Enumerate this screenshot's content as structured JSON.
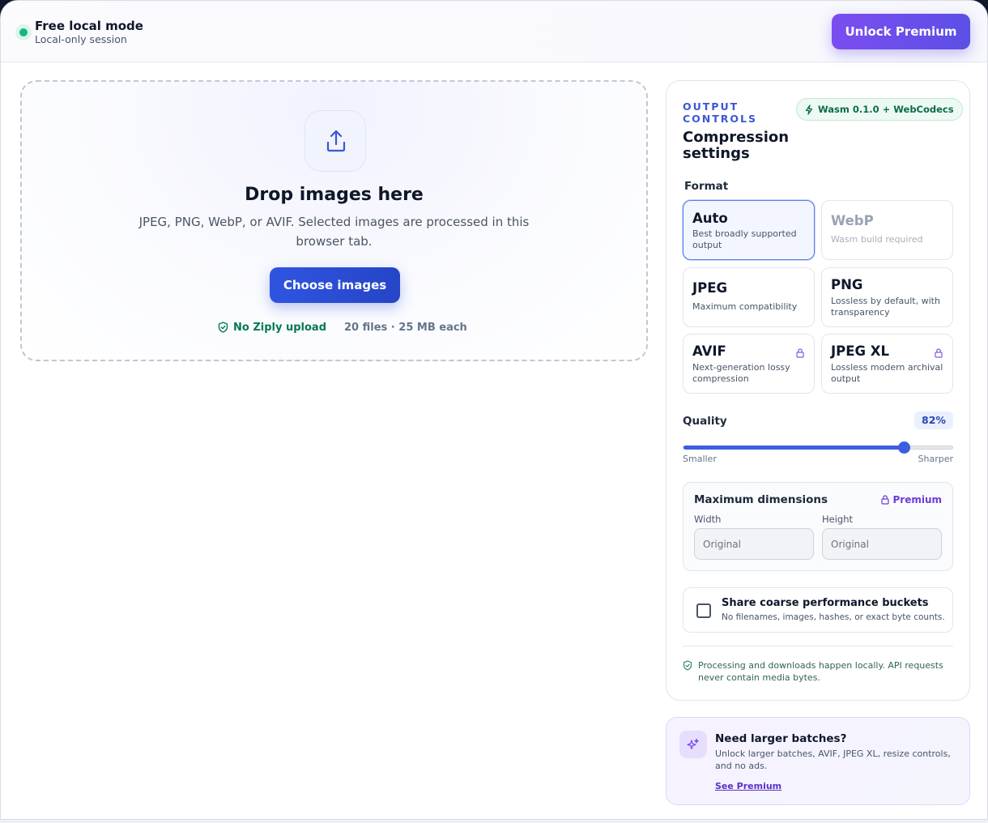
{
  "header": {
    "mode_title": "Free local mode",
    "mode_subtitle": "Local-only session",
    "unlock_label": "Unlock Premium",
    "status_color": "#10b981"
  },
  "dropzone": {
    "icon": "upload-icon",
    "title": "Drop images here",
    "subtitle": "JPEG, PNG, WebP, or AVIF. Selected images are processed in this browser tab.",
    "button_label": "Choose images",
    "no_upload_label": "No Ziply upload",
    "limits_label": "20 files · 25 MB each"
  },
  "panel": {
    "eyebrow": "OUTPUT CONTROLS",
    "title": "Compression settings",
    "engine_badge": "Wasm 0.1.0 + WebCodecs",
    "format_label": "Format",
    "formats": [
      {
        "name": "Auto",
        "desc": "Best broadly supported output",
        "state": "selected",
        "locked": false
      },
      {
        "name": "WebP",
        "desc": "Wasm build required",
        "state": "disabled",
        "locked": false
      },
      {
        "name": "JPEG",
        "desc": "Maximum compatibility",
        "state": "normal",
        "locked": false
      },
      {
        "name": "PNG",
        "desc": "Lossless by default, with transparency",
        "state": "normal",
        "locked": false
      },
      {
        "name": "AVIF",
        "desc": "Next-generation lossy compression",
        "state": "normal",
        "locked": true
      },
      {
        "name": "JPEG XL",
        "desc": "Lossless modern archival output",
        "state": "normal",
        "locked": true
      }
    ],
    "quality": {
      "label": "Quality",
      "value": 82,
      "value_label": "82%",
      "min_label": "Smaller",
      "max_label": "Sharper"
    },
    "dimensions": {
      "title": "Maximum dimensions",
      "premium_label": "Premium",
      "width_label": "Width",
      "height_label": "Height",
      "width_placeholder": "Original",
      "height_placeholder": "Original"
    },
    "share": {
      "title": "Share coarse performance buckets",
      "subtitle": "No filenames, images, hashes, or exact byte counts.",
      "checked": false
    },
    "local_note": "Processing and downloads happen locally. API requests never contain media bytes."
  },
  "promo": {
    "title": "Need larger batches?",
    "subtitle": "Unlock larger batches, AVIF, JPEG XL, resize controls, and no ads.",
    "link_label": "See Premium"
  },
  "colors": {
    "primary": "#2f55e0",
    "premium": "#7c4df0",
    "success": "#047857"
  }
}
